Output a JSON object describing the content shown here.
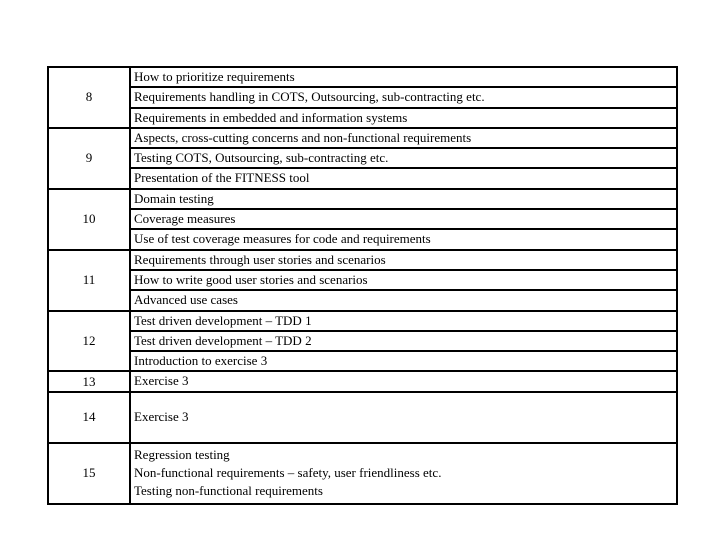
{
  "schedule": [
    {
      "week": "8",
      "topics": [
        "How to prioritize requirements",
        "Requirements handling in COTS, Outsourcing, sub-contracting etc.",
        "Requirements in embedded and information systems"
      ]
    },
    {
      "week": "9",
      "topics": [
        "Aspects, cross-cutting concerns and non-functional requirements",
        "Testing COTS, Outsourcing, sub-contracting etc.",
        "Presentation of the FITNESS tool"
      ]
    },
    {
      "week": "10",
      "topics": [
        "Domain testing",
        "Coverage measures",
        "Use of test coverage measures for code and requirements"
      ]
    },
    {
      "week": "11",
      "topics": [
        "Requirements through user stories and scenarios",
        "How to write good user stories and scenarios",
        "Advanced use cases"
      ]
    },
    {
      "week": "12",
      "topics": [
        "Test driven development – TDD 1",
        "Test driven development – TDD 2",
        "Introduction to exercise 3"
      ]
    },
    {
      "week": "13",
      "topics": [
        "Exercise 3"
      ]
    },
    {
      "week": "14",
      "topics": [
        "Exercise 3"
      ]
    },
    {
      "week": "15",
      "topics": [
        "Regression testing",
        "Non-functional requirements – safety, user friendliness etc.",
        "Testing non-functional requirements"
      ]
    }
  ]
}
